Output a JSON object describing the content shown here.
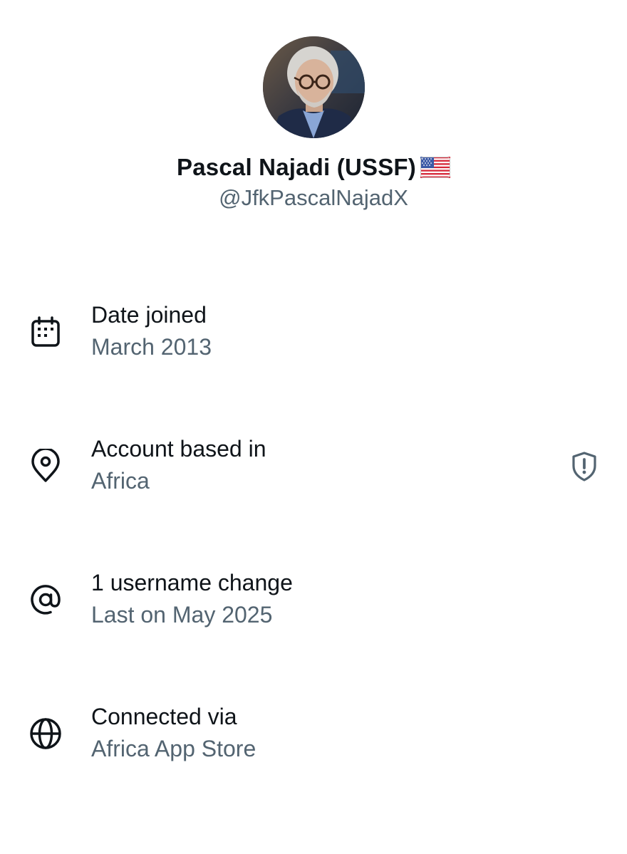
{
  "profile": {
    "display_name": "Pascal Najadi (USSF)",
    "flag_icon": "us-flag-icon",
    "handle": "@JfkPascalNajadX"
  },
  "colors": {
    "primary_text": "#0f1419",
    "secondary_text": "#536471",
    "background": "#ffffff"
  },
  "about": {
    "date_joined": {
      "icon": "calendar-icon",
      "label": "Date joined",
      "value": "March 2013"
    },
    "account_based_in": {
      "icon": "location-pin-icon",
      "label": "Account based in",
      "value": "Africa",
      "action_icon": "shield-alert-icon"
    },
    "username_changes": {
      "icon": "at-sign-icon",
      "label": "1 username change",
      "value": "Last on May 2025"
    },
    "connected_via": {
      "icon": "globe-icon",
      "label": "Connected via",
      "value": "Africa App Store"
    }
  }
}
